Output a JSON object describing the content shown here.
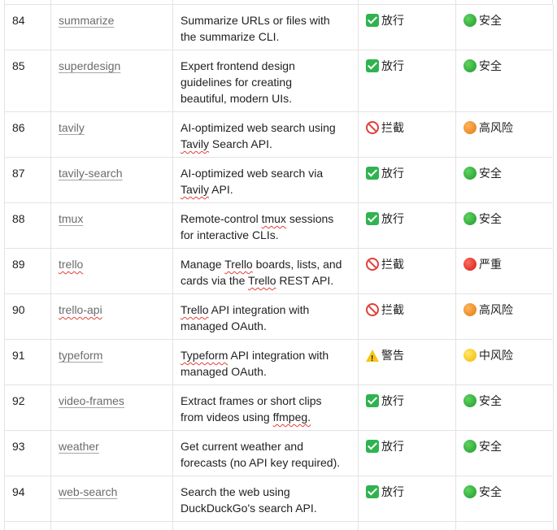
{
  "rows": [
    {
      "num": "84",
      "name": "summarize",
      "desc": [
        "Summarize URLs or files with",
        "the summarize CLI."
      ],
      "action": {
        "label": "放行",
        "icon": "check-icon"
      },
      "risk": {
        "label": "安全",
        "icon": "green-circle-icon"
      },
      "height": 55
    },
    {
      "num": "85",
      "name": "superdesign",
      "desc": [
        "Expert frontend design",
        "guidelines for creating",
        "beautiful, modern UIs."
      ],
      "action": {
        "label": "放行",
        "icon": "check-icon"
      },
      "risk": {
        "label": "安全",
        "icon": "green-circle-icon"
      },
      "height": 75
    },
    {
      "num": "86",
      "name": "tavily",
      "desc": [
        "AI-optimized web search using",
        "Tavily Search API."
      ],
      "action": {
        "label": "拦截",
        "icon": "prohibited-icon"
      },
      "risk": {
        "label": "高风险",
        "icon": "orange-circle-icon"
      },
      "height": 55
    },
    {
      "num": "87",
      "name": "tavily-search",
      "desc": [
        "AI-optimized web search via",
        "Tavily API."
      ],
      "action": {
        "label": "放行",
        "icon": "check-icon"
      },
      "risk": {
        "label": "安全",
        "icon": "green-circle-icon"
      },
      "height": 55
    },
    {
      "num": "88",
      "name": "tmux",
      "desc": [
        "Remote-control tmux sessions",
        "for interactive CLIs."
      ],
      "action": {
        "label": "放行",
        "icon": "check-icon"
      },
      "risk": {
        "label": "安全",
        "icon": "green-circle-icon"
      },
      "height": 55
    },
    {
      "num": "89",
      "name": "trello",
      "desc": [
        "Manage Trello boards, lists, and",
        "cards via the Trello REST API."
      ],
      "action": {
        "label": "拦截",
        "icon": "prohibited-icon"
      },
      "risk": {
        "label": "严重",
        "icon": "red-circle-icon"
      },
      "height": 55
    },
    {
      "num": "90",
      "name": "trello-api",
      "desc": [
        "Trello API integration with",
        "managed OAuth."
      ],
      "action": {
        "label": "拦截",
        "icon": "prohibited-icon"
      },
      "risk": {
        "label": "高风险",
        "icon": "orange-circle-icon"
      },
      "height": 55
    },
    {
      "num": "91",
      "name": "typeform",
      "desc": [
        "Typeform API integration with",
        "managed OAuth."
      ],
      "action": {
        "label": "警告",
        "icon": "warning-icon"
      },
      "risk": {
        "label": "中风险",
        "icon": "yellow-circle-icon"
      },
      "height": 55
    },
    {
      "num": "92",
      "name": "video-frames",
      "desc": [
        "Extract frames or short clips",
        "from videos using ffmpeg."
      ],
      "action": {
        "label": "放行",
        "icon": "check-icon"
      },
      "risk": {
        "label": "安全",
        "icon": "green-circle-icon"
      },
      "height": 55
    },
    {
      "num": "93",
      "name": "weather",
      "desc": [
        "Get current weather and",
        "forecasts (no API key required)."
      ],
      "action": {
        "label": "放行",
        "icon": "check-icon"
      },
      "risk": {
        "label": "安全",
        "icon": "green-circle-icon"
      },
      "height": 55
    },
    {
      "num": "94",
      "name": "web-search",
      "desc": [
        "Search the web using",
        "DuckDuckGo's search API."
      ],
      "action": {
        "label": "放行",
        "icon": "check-icon"
      },
      "risk": {
        "label": "安全",
        "icon": "green-circle-icon"
      },
      "height": 55
    }
  ]
}
